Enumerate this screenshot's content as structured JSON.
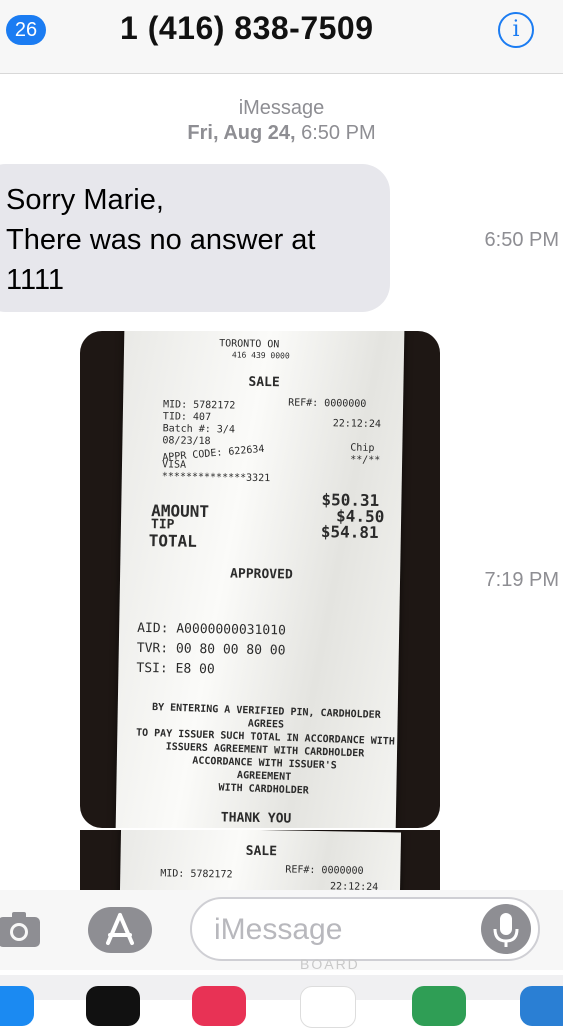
{
  "header": {
    "back_badge": "26",
    "contact": "1 (416) 838-7509",
    "info_label": "i"
  },
  "meta": {
    "service": "iMessage",
    "date_prefix": "Fri, Aug 24,",
    "date_time": "6:50 PM"
  },
  "messages": [
    {
      "text_lines": [
        "Sorry Marie,",
        "There was no answer at",
        "1111"
      ],
      "time": "6:50 PM"
    },
    {
      "type": "photo",
      "time": "7:19 PM"
    }
  ],
  "receipt": {
    "header_city": "TORONTO ON",
    "header_phone": "416 439 0000",
    "transaction": "SALE",
    "mid": "MID: 5782172",
    "tid": "TID: 407",
    "batch": "Batch #: 3/4",
    "date": "08/23/18",
    "ref": "REF#: 0000000",
    "time": "22:12:24",
    "appr_code": "APPR CODE: 622634",
    "entry": "Chip",
    "card_type": "VISA",
    "card_number": "**************3321",
    "card_exp": "**/**",
    "amount_label": "AMOUNT",
    "amount": "$50.31",
    "tip_label": "TIP",
    "tip": "$4.50",
    "total_label": "TOTAL",
    "total": "$54.81",
    "status": "APPROVED",
    "aid": "AID: A0000000031010",
    "tvr": "TVR: 00 80 00 80 00",
    "tsi": "TSI: E8 00",
    "disclaimer_lines": [
      "BY ENTERING A VERIFIED PIN, CARDHOLDER AGREES",
      "TO PAY ISSUER SUCH TOTAL IN ACCORDANCE WITH",
      "ISSUERS AGREEMENT WITH CARDHOLDER",
      "ACCORDANCE WITH ISSUER'S",
      "AGREEMENT",
      "WITH CARDHOLDER"
    ],
    "thank_you": "THANK YOU"
  },
  "input": {
    "placeholder": "iMessage"
  },
  "watermark": "BOARD",
  "colors": {
    "accent": "#1b7cf2",
    "bubble_bg": "#e7e7ec",
    "meta_text": "#8e8e93"
  },
  "icons": [
    "camera-icon",
    "appstore-icon",
    "microphone-icon",
    "info-icon"
  ]
}
